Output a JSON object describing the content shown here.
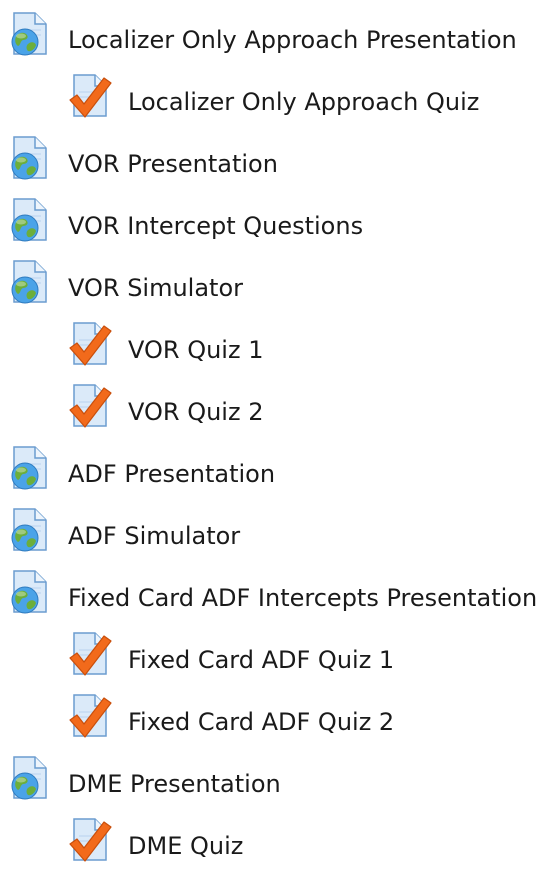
{
  "activities": [
    {
      "type": "page",
      "icon": "web-page-icon",
      "label": "Localizer Only Approach Presentation",
      "level": 0
    },
    {
      "type": "quiz",
      "icon": "quiz-icon",
      "label": "Localizer Only Approach Quiz",
      "level": 1
    },
    {
      "type": "page",
      "icon": "web-page-icon",
      "label": "VOR Presentation",
      "level": 0
    },
    {
      "type": "page",
      "icon": "web-page-icon",
      "label": "VOR Intercept Questions",
      "level": 0
    },
    {
      "type": "page",
      "icon": "web-page-icon",
      "label": "VOR Simulator",
      "level": 0
    },
    {
      "type": "quiz",
      "icon": "quiz-icon",
      "label": "VOR Quiz 1",
      "level": 1
    },
    {
      "type": "quiz",
      "icon": "quiz-icon",
      "label": "VOR Quiz 2",
      "level": 1
    },
    {
      "type": "page",
      "icon": "web-page-icon",
      "label": "ADF Presentation",
      "level": 0
    },
    {
      "type": "page",
      "icon": "web-page-icon",
      "label": "ADF Simulator",
      "level": 0
    },
    {
      "type": "page",
      "icon": "web-page-icon",
      "label": "Fixed Card ADF Intercepts Presentation",
      "level": 0
    },
    {
      "type": "quiz",
      "icon": "quiz-icon",
      "label": "Fixed Card ADF Quiz 1",
      "level": 1
    },
    {
      "type": "quiz",
      "icon": "quiz-icon",
      "label": "Fixed Card ADF Quiz 2",
      "level": 1
    },
    {
      "type": "page",
      "icon": "web-page-icon",
      "label": "DME Presentation",
      "level": 0
    },
    {
      "type": "quiz",
      "icon": "quiz-icon",
      "label": "DME Quiz",
      "level": 1
    }
  ],
  "colors": {
    "text": "#1a1a1a",
    "doc_fill": "#dbeaf9",
    "doc_stroke": "#6b9ccf",
    "globe_sea": "#4aa3e8",
    "globe_land": "#6cae3b",
    "check": "#f26a1b",
    "check_stroke": "#c94f0c"
  }
}
